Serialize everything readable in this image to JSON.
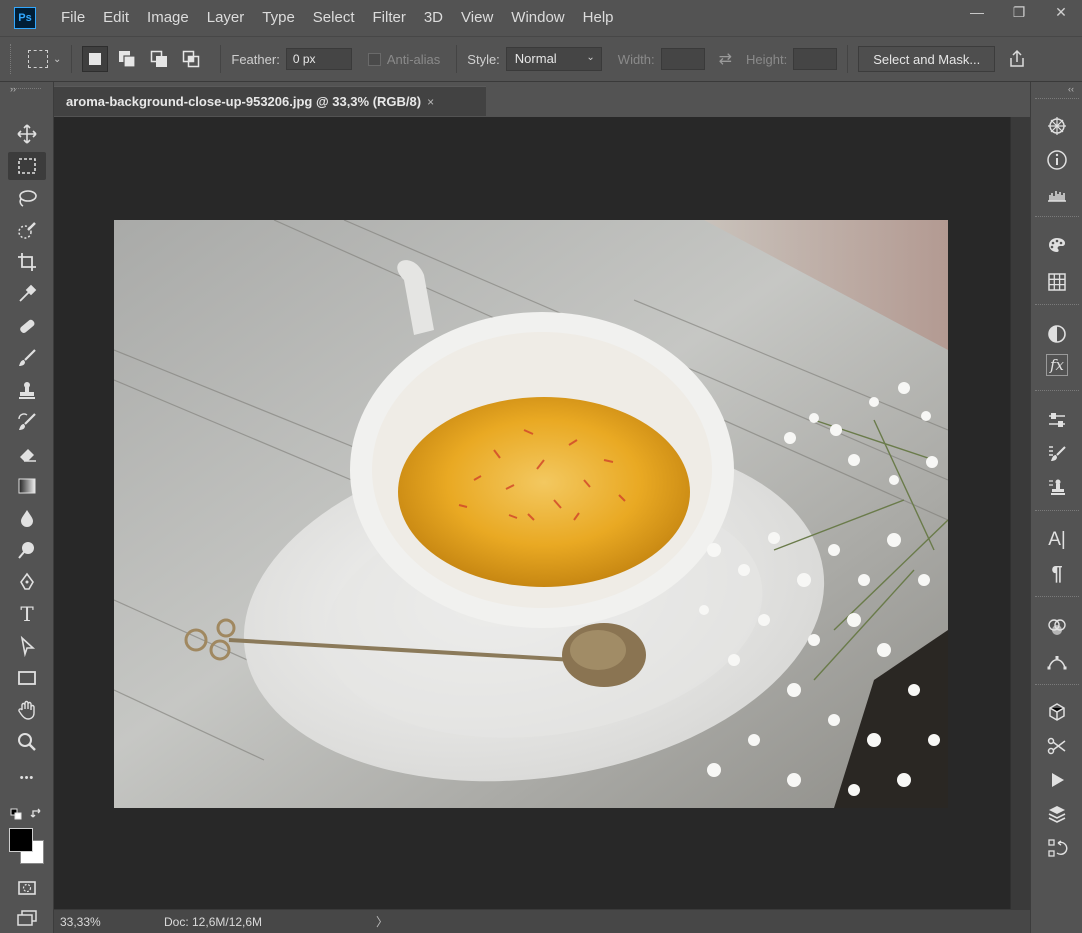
{
  "app": {
    "logo": "Ps"
  },
  "menu": [
    "File",
    "Edit",
    "Image",
    "Layer",
    "Type",
    "Select",
    "Filter",
    "3D",
    "View",
    "Window",
    "Help"
  ],
  "window_controls": {
    "minimize": "—",
    "restore": "❐",
    "close": "✕"
  },
  "options": {
    "feather_label": "Feather:",
    "feather_value": "0 px",
    "antialias_label": "Anti-alias",
    "style_label": "Style:",
    "style_value": "Normal",
    "width_label": "Width:",
    "height_label": "Height:",
    "select_mask_label": "Select and Mask..."
  },
  "document": {
    "tab_title": "aroma-background-close-up-953206.jpg @ 33,3% (RGB/8)",
    "close_glyph": "×"
  },
  "status": {
    "zoom": "33,33%",
    "doc": "Doc: 12,6M/12,6M",
    "arrow": "〉"
  },
  "toolbar": {
    "collapse": "››",
    "tools": [
      "move-tool",
      "rectangular-marquee-tool",
      "lasso-tool",
      "quick-selection-tool",
      "crop-tool",
      "eyedropper-tool",
      "spot-healing-tool",
      "brush-tool",
      "clone-stamp-tool",
      "history-brush-tool",
      "eraser-tool",
      "gradient-tool",
      "blur-tool",
      "dodge-tool",
      "pen-tool",
      "type-tool",
      "path-selection-tool",
      "rectangle-tool",
      "hand-tool",
      "zoom-tool",
      "edit-toolbar",
      "swap-colors",
      "foreground-color",
      "quick-mask",
      "screen-mode"
    ],
    "more_glyph": "•••",
    "type_glyph": "T"
  },
  "right_dock": {
    "collapse": "‹‹",
    "panels": [
      "navigator-icon",
      "info-icon",
      "histogram-icon",
      "color-icon",
      "swatches-icon",
      "adjustments-icon",
      "styles-icon",
      "properties-icon",
      "brush-settings-icon",
      "clone-source-icon",
      "character-icon",
      "paragraph-icon",
      "channels-icon",
      "paths-icon",
      "3d-icon",
      "tools-preset-icon",
      "actions-icon",
      "layers-icon",
      "history-icon"
    ],
    "character_glyph": "A|",
    "paragraph_glyph": "¶",
    "styles_glyph": "fx"
  },
  "colors": {
    "ui_bg": "#535353",
    "canvas_bg": "#282828",
    "accent": "#31a8ff",
    "foreground": "#000000",
    "background": "#ffffff"
  }
}
